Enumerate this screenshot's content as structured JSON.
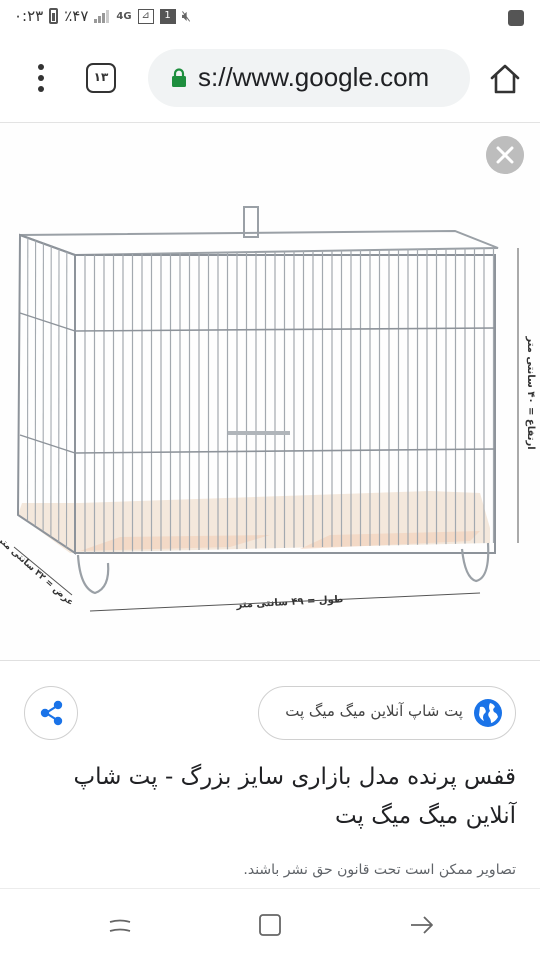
{
  "status_bar": {
    "time": "۰:۲۳",
    "battery": "٪۴۷",
    "network": "4G",
    "notification_count": "1"
  },
  "toolbar": {
    "tab_count": "۱۳",
    "url": "s://www.google.com",
    "icons": [
      "menu-icon",
      "tabs-icon",
      "lock-icon",
      "home-icon"
    ]
  },
  "image": {
    "label_height": "ارتفاع = ۴۰ سانتی متر",
    "label_length": "طول = ۴۹ سانتی متر",
    "label_width": "عرض = ۳۲ سانتی متر"
  },
  "result": {
    "source": "پت شاپ آنلاین میگ میگ پت",
    "title": "قفس پرنده مدل بازاری سایز بزرگ - پت شاپ آنلاین میگ میگ پت",
    "copyright": "تصاویر ممکن است تحت قانون حق نشر باشند."
  },
  "colors": {
    "lock": "#1e8e3e",
    "globe": "#1a73e8",
    "share": "#1a73e8",
    "close_bg": "#bdbdbd"
  }
}
